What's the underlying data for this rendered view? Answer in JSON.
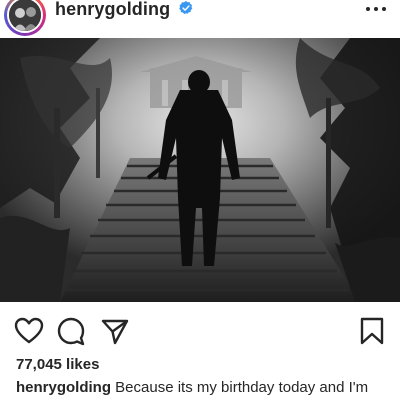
{
  "post": {
    "username": "henrygolding",
    "verified": true,
    "likes_text": "77,045 likes",
    "caption_username": "henrygolding",
    "caption_text": " Because its my birthday today and I'm"
  },
  "icons": {
    "header_more": "more-horizontal-icon",
    "verified_badge": "verified-badge-icon",
    "like": "heart-icon",
    "comment": "comment-icon",
    "share": "paper-plane-icon",
    "save": "bookmark-icon"
  },
  "colors": {
    "text": "#262626",
    "verified": "#3897f0",
    "background": "#ffffff"
  }
}
